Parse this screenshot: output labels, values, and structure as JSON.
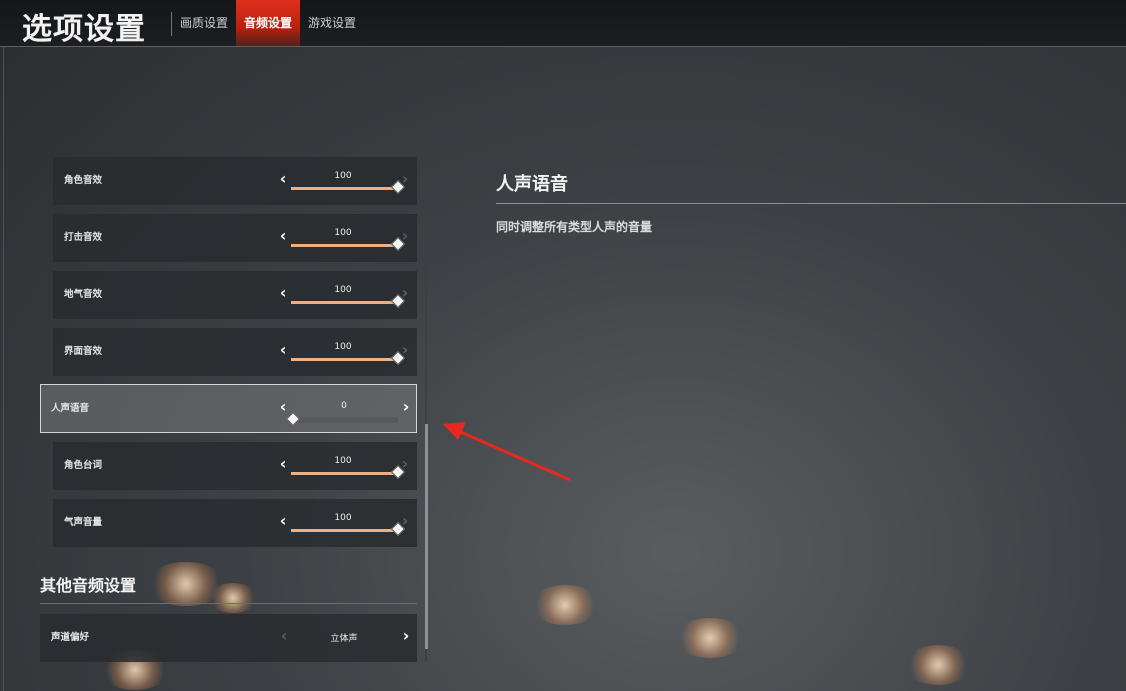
{
  "header": {
    "title": "选项设置",
    "tabs": [
      {
        "label": "画质设置",
        "active": false
      },
      {
        "label": "音频设置",
        "active": true
      },
      {
        "label": "游戏设置",
        "active": false
      }
    ]
  },
  "settings": {
    "rows": [
      {
        "label": "角色音效",
        "value": "100",
        "level": 1.0
      },
      {
        "label": "打击音效",
        "value": "100",
        "level": 1.0
      },
      {
        "label": "地气音效",
        "value": "100",
        "level": 1.0
      },
      {
        "label": "界面音效",
        "value": "100",
        "level": 1.0
      },
      {
        "label": "人声语音",
        "value": "0",
        "level": 0.0,
        "selected": true
      },
      {
        "label": "角色台词",
        "value": "100",
        "level": 1.0
      },
      {
        "label": "气声音量",
        "value": "100",
        "level": 1.0
      }
    ],
    "other_section": {
      "heading": "其他音频设置",
      "channel": {
        "label": "声道偏好",
        "value": "立体声"
      }
    }
  },
  "detail": {
    "title": "人声语音",
    "description": "同时调整所有类型人声的音量"
  },
  "icons": {
    "arrow_left": "‹",
    "arrow_right": "›"
  },
  "colors": {
    "accent_tab": "#d42a16",
    "slider_fill": "#eeaf82",
    "annotation_arrow": "#e8281c"
  }
}
